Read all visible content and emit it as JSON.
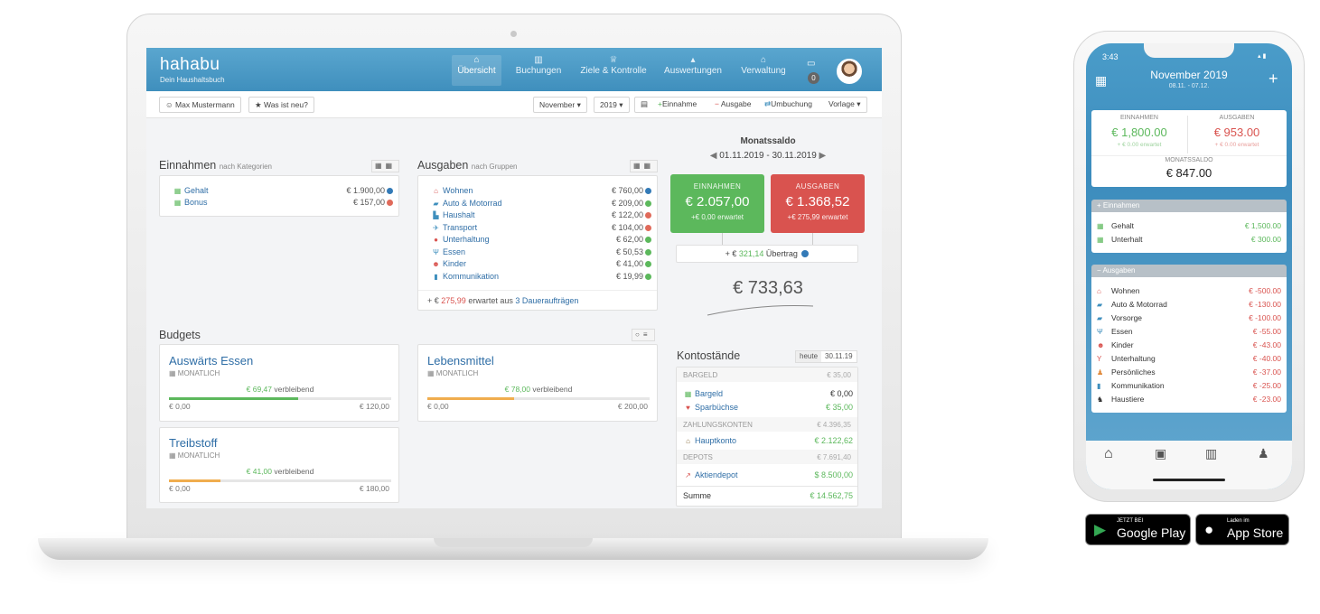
{
  "app": {
    "brand": "hahabu",
    "tagline": "Dein Haushaltsbuch"
  },
  "nav": [
    {
      "label": "Übersicht",
      "icon": "home-icon",
      "active": true
    },
    {
      "label": "Buchungen",
      "icon": "book-icon"
    },
    {
      "label": "Ziele & Kontrolle",
      "icon": "trophy-icon"
    },
    {
      "label": "Auswertungen",
      "icon": "chart-icon"
    },
    {
      "label": "Verwaltung",
      "icon": "bank-icon"
    }
  ],
  "nav_badge": "0",
  "toolbar": {
    "user": "Max Mustermann",
    "whats_new": "Was ist neu?",
    "month": "November",
    "year": "2019",
    "income": "Einnahme",
    "expense": "Ausgabe",
    "transfer": "Umbuchung",
    "template": "Vorlage"
  },
  "income": {
    "title": "Einnahmen",
    "subtitle": "nach Kategorien",
    "items": [
      {
        "label": "Gehalt",
        "value": "€ 1.900,00",
        "icon": "money-icon",
        "status_color": "#337ab7"
      },
      {
        "label": "Bonus",
        "value": "€ 157,00",
        "icon": "money-icon",
        "status_color": "#e06a5a"
      }
    ]
  },
  "expenses": {
    "title": "Ausgaben",
    "subtitle": "nach Gruppen",
    "items": [
      {
        "label": "Wohnen",
        "value": "€ 760,00",
        "icon": "house-icon",
        "status_color": "#337ab7"
      },
      {
        "label": "Auto & Motorrad",
        "value": "€ 209,00",
        "icon": "car-icon",
        "status_color": "#5cb85c"
      },
      {
        "label": "Haushalt",
        "value": "€ 122,00",
        "icon": "cart-icon",
        "status_color": "#e06a5a"
      },
      {
        "label": "Transport",
        "value": "€ 104,00",
        "icon": "plane-icon",
        "status_color": "#e06a5a"
      },
      {
        "label": "Unterhaltung",
        "value": "€ 62,00",
        "icon": "pin-icon",
        "status_color": "#5cb85c"
      },
      {
        "label": "Essen",
        "value": "€ 50,53",
        "icon": "cutlery-icon",
        "status_color": "#5cb85c"
      },
      {
        "label": "Kinder",
        "value": "€ 41,00",
        "icon": "kids-icon",
        "status_color": "#5cb85c"
      },
      {
        "label": "Kommunikation",
        "value": "€ 19,99",
        "icon": "phone-icon",
        "status_color": "#5cb85c"
      }
    ],
    "footer_prefix": "+ €",
    "footer_amount": "275,99",
    "footer_mid": "erwartet aus",
    "footer_link": "3 Daueraufträgen"
  },
  "saldo": {
    "title": "Monatssaldo",
    "period": "01.11.2019 - 30.11.2019",
    "income_label": "EINNAHMEN",
    "income_value": "€ 2.057,00",
    "income_expected": "+€ 0,00 erwartet",
    "expense_label": "AUSGABEN",
    "expense_value": "€ 1.368,52",
    "expense_expected": "+€ 275,99 erwartet",
    "carry_prefix": "+ €",
    "carry_amount": "321,14",
    "carry_label": "Übertrag",
    "total": "€ 733,63"
  },
  "budgets": {
    "title": "Budgets",
    "items": [
      {
        "name": "Auswärts Essen",
        "period": "MONATLICH",
        "remaining": "€ 69,47",
        "remaining_label": "verbleibend",
        "min": "€ 0,00",
        "max": "€ 120,00",
        "used_fraction": 0.58,
        "color": "#5cb85c"
      },
      {
        "name": "Lebensmittel",
        "period": "MONATLICH",
        "remaining": "€ 78,00",
        "remaining_label": "verbleibend",
        "min": "€ 0,00",
        "max": "€ 200,00",
        "used_fraction": 0.39,
        "color": "#f0ad4e"
      },
      {
        "name": "Treibstoff",
        "period": "MONATLICH",
        "remaining": "€ 41,00",
        "remaining_label": "verbleibend",
        "min": "€ 0,00",
        "max": "€ 180,00",
        "used_fraction": 0.23,
        "color": "#f0ad4e"
      }
    ]
  },
  "accounts": {
    "title": "Kontostände",
    "today": "heute",
    "date": "30.11.19",
    "groups": [
      {
        "name": "BARGELD",
        "total": "€ 35,00",
        "items": [
          {
            "label": "Bargeld",
            "value": "€ 0,00",
            "icon": "money-icon"
          },
          {
            "label": "Sparbüchse",
            "value": "€ 35,00",
            "icon": "piggy-icon"
          }
        ]
      },
      {
        "name": "ZAHLUNGSKONTEN",
        "total": "€ 4.396,35",
        "items": [
          {
            "label": "Hauptkonto",
            "value": "€ 2.122,62",
            "icon": "bank-icon"
          }
        ]
      },
      {
        "name": "DEPOTS",
        "total": "€ 7.691,40",
        "items": [
          {
            "label": "Aktiendepot",
            "value": "$ 8.500,00",
            "icon": "stock-icon"
          }
        ]
      }
    ],
    "sum_label": "Summe",
    "sum_value": "€ 14.562,75"
  },
  "phone": {
    "time": "3:43",
    "month": "November 2019",
    "range": "08.11. - 07.12.",
    "income_label": "EINNAHMEN",
    "income_value": "€ 1,800.00",
    "income_expected": "+ € 0.00 erwartet",
    "expense_label": "AUSGABEN",
    "expense_value": "€ 953.00",
    "expense_expected": "+ € 0.00 erwartet",
    "balance_label": "MONATSSALDO",
    "balance_value": "€ 847.00",
    "income_section": "Einnahmen",
    "income_items": [
      {
        "label": "Gehalt",
        "value": "€ 1,500.00"
      },
      {
        "label": "Unterhalt",
        "value": "€ 300.00"
      }
    ],
    "expense_section": "Ausgaben",
    "expense_items": [
      {
        "label": "Wohnen",
        "value": "€ -500.00",
        "icon": "house-icon"
      },
      {
        "label": "Auto & Motorrad",
        "value": "€ -130.00",
        "icon": "car-icon"
      },
      {
        "label": "Vorsorge",
        "value": "€ -100.00",
        "icon": "car-icon"
      },
      {
        "label": "Essen",
        "value": "€ -55.00",
        "icon": "cutlery-icon"
      },
      {
        "label": "Kinder",
        "value": "€ -43.00",
        "icon": "kids-icon"
      },
      {
        "label": "Unterhaltung",
        "value": "€ -40.00",
        "icon": "wine-icon"
      },
      {
        "label": "Persönliches",
        "value": "€ -37.00",
        "icon": "person-icon"
      },
      {
        "label": "Kommunikation",
        "value": "€ -25.00",
        "icon": "phone-icon"
      },
      {
        "label": "Haustiere",
        "value": "€ -23.00",
        "icon": "pet-icon"
      }
    ]
  },
  "stores": {
    "google_small": "JETZT BEI",
    "google_big": "Google Play",
    "apple_small": "Laden im",
    "apple_big": "App Store"
  },
  "colors": {
    "green": "#5cb85c",
    "red": "#d9534f",
    "blue": "#3f8fbd"
  }
}
